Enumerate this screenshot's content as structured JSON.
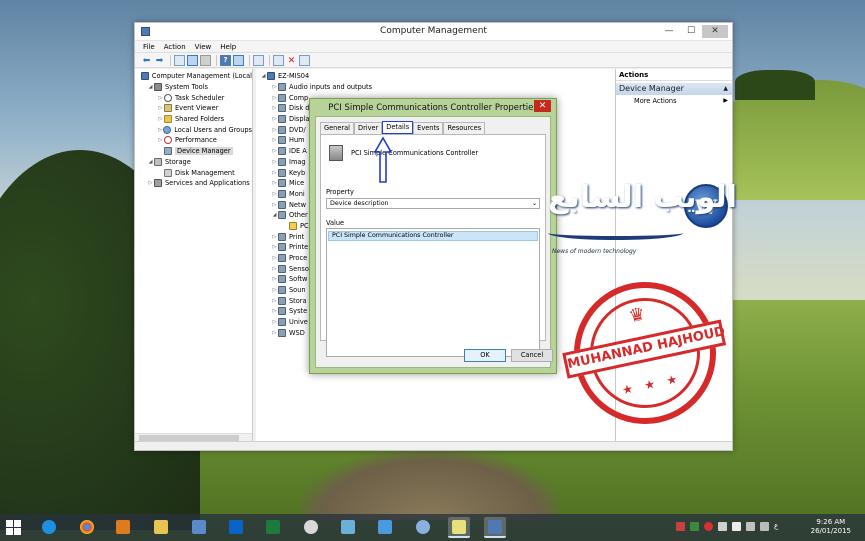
{
  "window": {
    "title": "Computer Management",
    "controls": {
      "minimize": "—",
      "maximize": "☐",
      "close": "✕"
    }
  },
  "menubar": [
    "File",
    "Action",
    "View",
    "Help"
  ],
  "left_tree": [
    {
      "label": "Computer Management (Local",
      "indent": 0,
      "icon": "computer-icon",
      "expander": ""
    },
    {
      "label": "System Tools",
      "indent": 1,
      "icon": "tools-icon",
      "expander": "◢"
    },
    {
      "label": "Task Scheduler",
      "indent": 2,
      "icon": "clock-icon",
      "expander": "▷"
    },
    {
      "label": "Event Viewer",
      "indent": 2,
      "icon": "event-viewer-icon",
      "expander": "▷"
    },
    {
      "label": "Shared Folders",
      "indent": 2,
      "icon": "shared-folder-icon",
      "expander": "▷"
    },
    {
      "label": "Local Users and Groups",
      "indent": 2,
      "icon": "users-icon",
      "expander": "▷"
    },
    {
      "label": "Performance",
      "indent": 2,
      "icon": "performance-icon",
      "expander": "▷"
    },
    {
      "label": "Device Manager",
      "indent": 2,
      "icon": "device-manager-icon",
      "expander": "",
      "selected": true
    },
    {
      "label": "Storage",
      "indent": 1,
      "icon": "storage-icon",
      "expander": "◢"
    },
    {
      "label": "Disk Management",
      "indent": 2,
      "icon": "disk-icon",
      "expander": ""
    },
    {
      "label": "Services and Applications",
      "indent": 1,
      "icon": "services-icon",
      "expander": "▷"
    }
  ],
  "device_tree": [
    {
      "label": "EZ-MIS04",
      "expander": "◢",
      "indent": 0
    },
    {
      "label": "Audio inputs and outputs",
      "expander": "▷",
      "indent": 1
    },
    {
      "label": "Comp",
      "expander": "▷",
      "indent": 1
    },
    {
      "label": "Disk d",
      "expander": "▷",
      "indent": 1
    },
    {
      "label": "Displa",
      "expander": "▷",
      "indent": 1
    },
    {
      "label": "DVD/",
      "expander": "▷",
      "indent": 1
    },
    {
      "label": "Hum",
      "expander": "▷",
      "indent": 1
    },
    {
      "label": "IDE A",
      "expander": "▷",
      "indent": 1
    },
    {
      "label": "Imag",
      "expander": "▷",
      "indent": 1
    },
    {
      "label": "Keyb",
      "expander": "▷",
      "indent": 1
    },
    {
      "label": "Mice",
      "expander": "▷",
      "indent": 1
    },
    {
      "label": "Moni",
      "expander": "▷",
      "indent": 1
    },
    {
      "label": "Netw",
      "expander": "▷",
      "indent": 1
    },
    {
      "label": "Other",
      "expander": "◢",
      "indent": 1
    },
    {
      "label": "PC",
      "expander": "",
      "indent": 2,
      "warn": true
    },
    {
      "label": "Print",
      "expander": "▷",
      "indent": 1
    },
    {
      "label": "Printe",
      "expander": "▷",
      "indent": 1
    },
    {
      "label": "Proce",
      "expander": "▷",
      "indent": 1
    },
    {
      "label": "Senso",
      "expander": "▷",
      "indent": 1
    },
    {
      "label": "Softw",
      "expander": "▷",
      "indent": 1
    },
    {
      "label": "Soun",
      "expander": "▷",
      "indent": 1
    },
    {
      "label": "Stora",
      "expander": "▷",
      "indent": 1
    },
    {
      "label": "Syste",
      "expander": "▷",
      "indent": 1
    },
    {
      "label": "Unive",
      "expander": "▷",
      "indent": 1
    },
    {
      "label": "WSD",
      "expander": "▷",
      "indent": 1
    }
  ],
  "actions": {
    "header": "Actions",
    "section": "Device Manager",
    "section_arrow": "▲",
    "items": [
      {
        "label": "More Actions",
        "arrow": "▶"
      }
    ]
  },
  "dialog": {
    "title": "PCI Simple Communications Controller Properties",
    "close": "✕",
    "tabs": [
      "General",
      "Driver",
      "Details",
      "Events",
      "Resources"
    ],
    "active_tab": "Details",
    "device_name": "PCI Simple Communications Controller",
    "property_label": "Property",
    "property_value": "Device description",
    "value_label": "Value",
    "values": [
      "PCI Simple Communications Controller"
    ],
    "ok": "OK",
    "cancel": "Cancel"
  },
  "watermark": {
    "logo_text": "الويب السابع",
    "logo_subtitle": "News of modern technology",
    "globe_letter": "W",
    "stamp_text": "MUHANNAD HAJHOUD",
    "stamp_crown": "♛",
    "stamp_stars": "★ ★ ★"
  },
  "taskbar": {
    "time": "9:26 AM",
    "date": "26/01/2015",
    "colors": {
      "accent": "#cfe2f7",
      "background": "#28323c"
    }
  },
  "colors": {
    "dialog_frame": "#b8d39a",
    "annotation_blue": "#1f3fd0",
    "stamp_red": "#d41f1f"
  }
}
